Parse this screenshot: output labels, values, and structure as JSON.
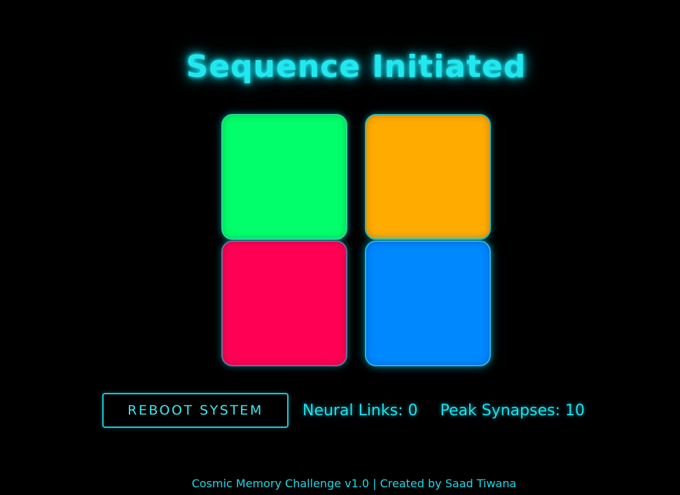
{
  "game": {
    "title": "Sequence Initiated",
    "pads": [
      {
        "color_name": "green",
        "color": "#00ff6a"
      },
      {
        "color_name": "orange",
        "color": "#ffab00"
      },
      {
        "color_name": "red",
        "color": "#ff0055"
      },
      {
        "color_name": "blue",
        "color": "#0088ff"
      }
    ],
    "accent_color": "#22e8ee"
  },
  "controls": {
    "reboot_label": "REBOOT SYSTEM"
  },
  "stats": {
    "neural_links_label": "Neural Links:",
    "neural_links_value": "0",
    "peak_synapses_label": "Peak Synapses:",
    "peak_synapses_value": "10"
  },
  "footer": {
    "text": "Cosmic Memory Challenge v1.0 | Created by Saad Tiwana"
  }
}
